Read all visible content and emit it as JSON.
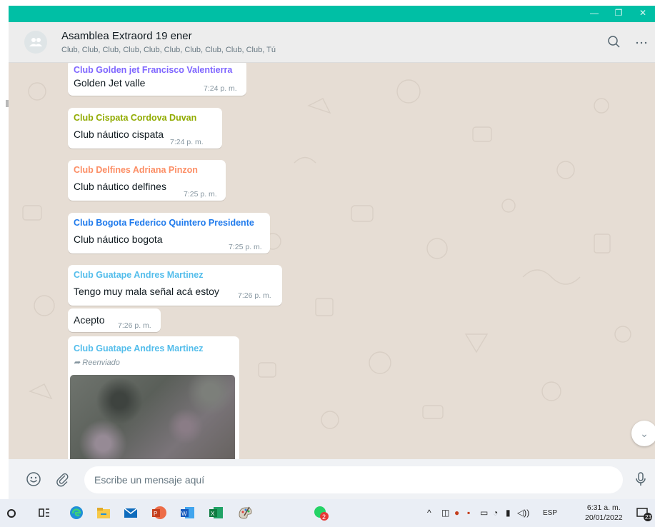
{
  "window": {
    "minimize_glyph": "—",
    "maximize_glyph": "❐",
    "close_glyph": "✕"
  },
  "header": {
    "title": "Asamblea Extraord 19 ener",
    "members": "Club, Club, Club, Club, Club, Club, Club, Club, Club, Club, Tú",
    "icons": [
      "group-avatar-icon",
      "search-icon",
      "menu-icon"
    ]
  },
  "messages": [
    {
      "sender": "Club Golden jet Francisco Valentierra",
      "sender_color": "#7f66ff",
      "text": "Golden  Jet valle",
      "time": "7:24 p. m."
    },
    {
      "sender": "Club Cispata Cordova Duvan",
      "sender_color": "#91ab01",
      "text": "Club náutico cispata",
      "time": "7:24 p. m."
    },
    {
      "sender": "Club Delfines Adriana Pinzon",
      "sender_color": "#fc8e65",
      "text": "Club náutico delfines",
      "time": "7:25 p. m."
    },
    {
      "sender": "Club Bogota Federico Quintero Presidente",
      "sender_color": "#1f7aec",
      "text": "Club náutico bogota",
      "time": "7:25 p. m."
    },
    {
      "sender": "Club Guatape Andres Martinez",
      "sender_color": "#53bdeb",
      "text": "Tengo muy  mala señal acá estoy",
      "time": "7:26 p. m."
    },
    {
      "sender": "",
      "text": "Acepto",
      "time": "7:26 p. m."
    },
    {
      "sender": "Club Guatape Andres Martinez",
      "sender_color": "#53bdeb",
      "forwarded": "Reenviado",
      "has_image": true
    }
  ],
  "composer": {
    "placeholder": "Escribe un mensaje aquí",
    "icons": [
      "emoji-icon",
      "attach-icon",
      "microphone-icon"
    ]
  },
  "taskbar": {
    "apps": [
      "cortana-icon",
      "task-view-icon",
      "edge-icon",
      "file-explorer-icon",
      "mail-icon",
      "powerpoint-icon",
      "word-icon",
      "excel-icon",
      "paint-icon",
      "whatsapp-icon"
    ],
    "whatsapp_badge": "2",
    "language": "ESP",
    "time": "6:31 a. m.",
    "date": "20/01/2022",
    "notifications": "23"
  },
  "colors": {
    "accent": "#00bfa5",
    "chat_bg": "#e6ddd4",
    "header_bg": "#ededed",
    "composer_bg": "#f0f2f5"
  }
}
